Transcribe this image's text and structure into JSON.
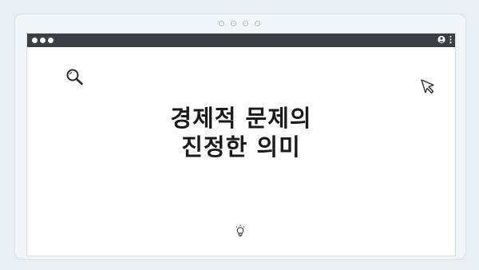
{
  "pager": {
    "dots": 4
  },
  "window": {
    "traffic_lights": 3
  },
  "icons": {
    "search": "search-icon",
    "cursor": "cursor-icon",
    "user": "user-icon",
    "menu": "kebab-menu-icon",
    "bulb": "lightbulb-icon"
  },
  "headline": {
    "line1": "경제적 문제의",
    "line2": "진정한 의미"
  },
  "colors": {
    "background": "#e9eef2",
    "titlebar": "#3b3f44",
    "text": "#1a1a1a"
  }
}
